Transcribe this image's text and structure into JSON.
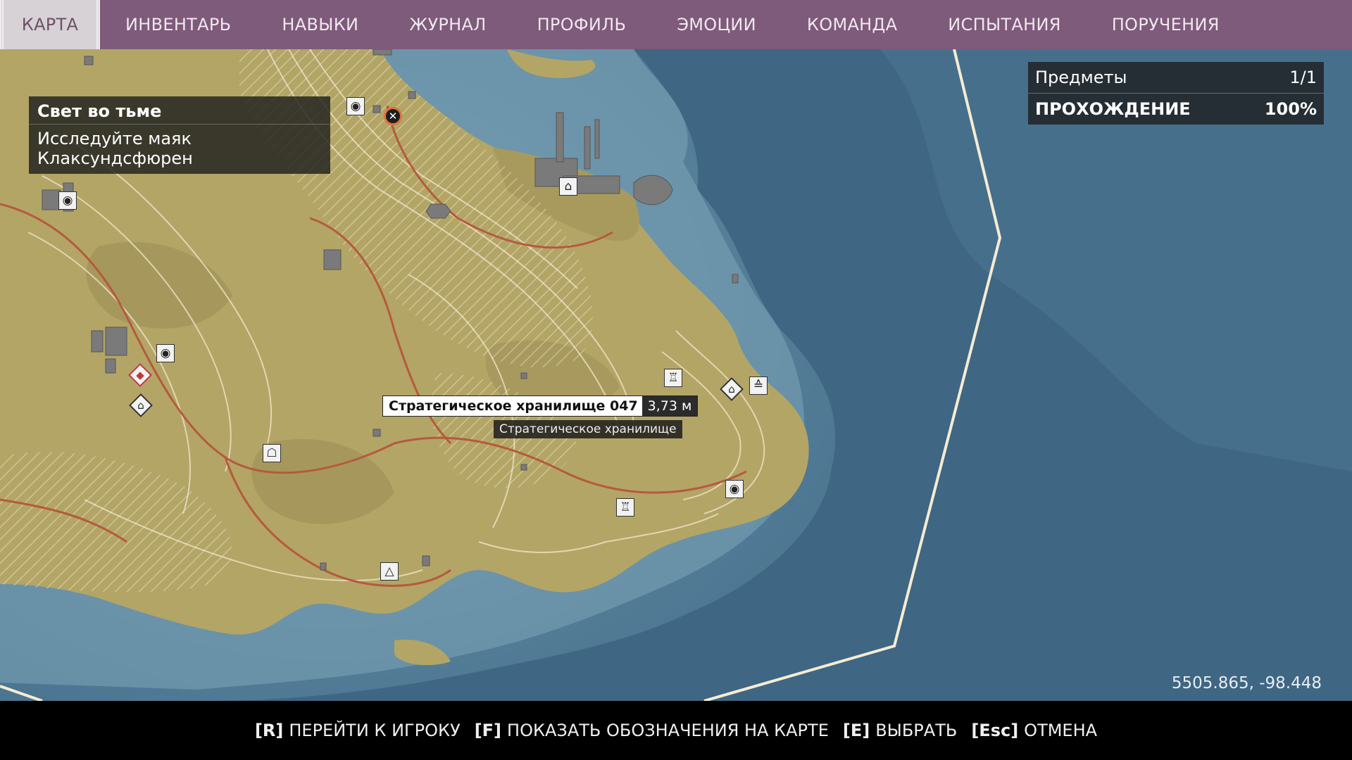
{
  "nav": {
    "tabs": [
      "КАРТА",
      "ИНВЕНТАРЬ",
      "НАВЫКИ",
      "ЖУРНАЛ",
      "ПРОФИЛЬ",
      "ЭМОЦИИ",
      "КОМАНДА",
      "ИСПЫТАНИЯ",
      "ПОРУЧЕНИЯ"
    ],
    "active": "КАРТА"
  },
  "quest": {
    "title": "Свет во тьме",
    "description": "Исследуйте маяк Клаксундсфюрен"
  },
  "stats": {
    "items_label": "Предметы",
    "items_value": "1/1",
    "progress_label": "ПРОХОЖДЕНИЕ",
    "progress_value": "100%"
  },
  "tooltip": {
    "name": "Стратегическое хранилище 047",
    "distance": "3,73 м",
    "category": "Стратегическое хранилище"
  },
  "coordinates": "5505.865, -98.448",
  "controls": [
    {
      "key": "[R]",
      "label": "ПЕРЕЙТИ К ИГРОКУ"
    },
    {
      "key": "[F]",
      "label": "ПОКАЗАТЬ ОБОЗНАЧЕНИЯ НА КАРТЕ"
    },
    {
      "key": "[E]",
      "label": "ВЫБРАТЬ"
    },
    {
      "key": "[Esc]",
      "label": "ОТМЕНА"
    }
  ],
  "colors": {
    "nav_bg": "#7e5a7b",
    "sea_deep": "#3f6683",
    "land": "#b3a566",
    "road": "#b55a3e",
    "boundary": "#f5ecd2"
  }
}
